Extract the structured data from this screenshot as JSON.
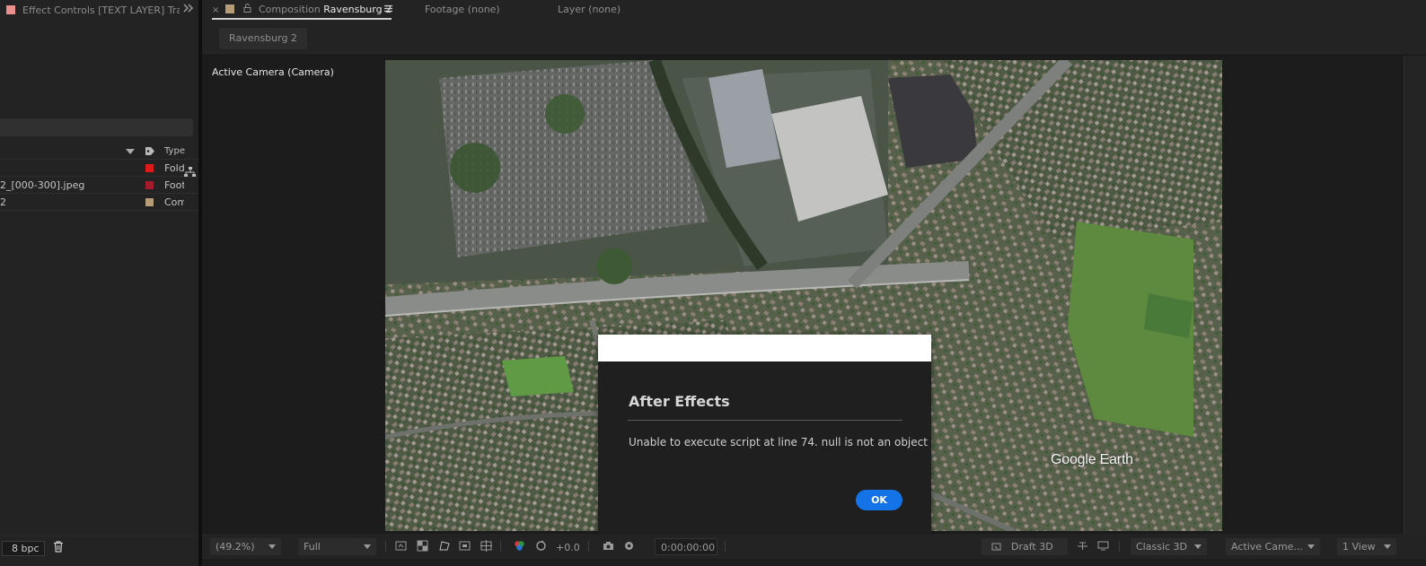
{
  "left_panel": {
    "tab_label": "Effect Controls [TEXT LAYER] Track P",
    "overflow_icon": "double-chevron-right",
    "type_header": "Type",
    "rows": [
      {
        "name": "",
        "type": "Fold",
        "color": "#e0191b"
      },
      {
        "name": "2_[000-300].jpeg",
        "type": "Foot",
        "color": "#a31b2c"
      },
      {
        "name": "2",
        "type": "Com",
        "color": "#b59d77"
      }
    ],
    "bpc_label": "8 bpc"
  },
  "comp_panel": {
    "tabs": {
      "close": "×",
      "composition_prefix": "Composition",
      "composition_name": "Ravensburg 2",
      "footage": "Footage (none)",
      "layer": "Layer (none)"
    },
    "breadcrumb": "Ravensburg 2",
    "camera_label": "Active Camera (Camera)",
    "watermark": "Google Earth"
  },
  "dialog": {
    "title": "After Effects",
    "message": "Unable to execute script at line 74. null is not an object",
    "ok_label": "OK",
    "ok_color": "#1473e6"
  },
  "toolbar": {
    "zoom": "(49.2%)",
    "resolution": "Full",
    "exposure": "+0.0",
    "timecode": "0:00:00:00",
    "renderer": "Draft 3D",
    "renderer_mode": "Classic 3D",
    "camera_view": "Active Came...",
    "view_layout": "1 View"
  }
}
